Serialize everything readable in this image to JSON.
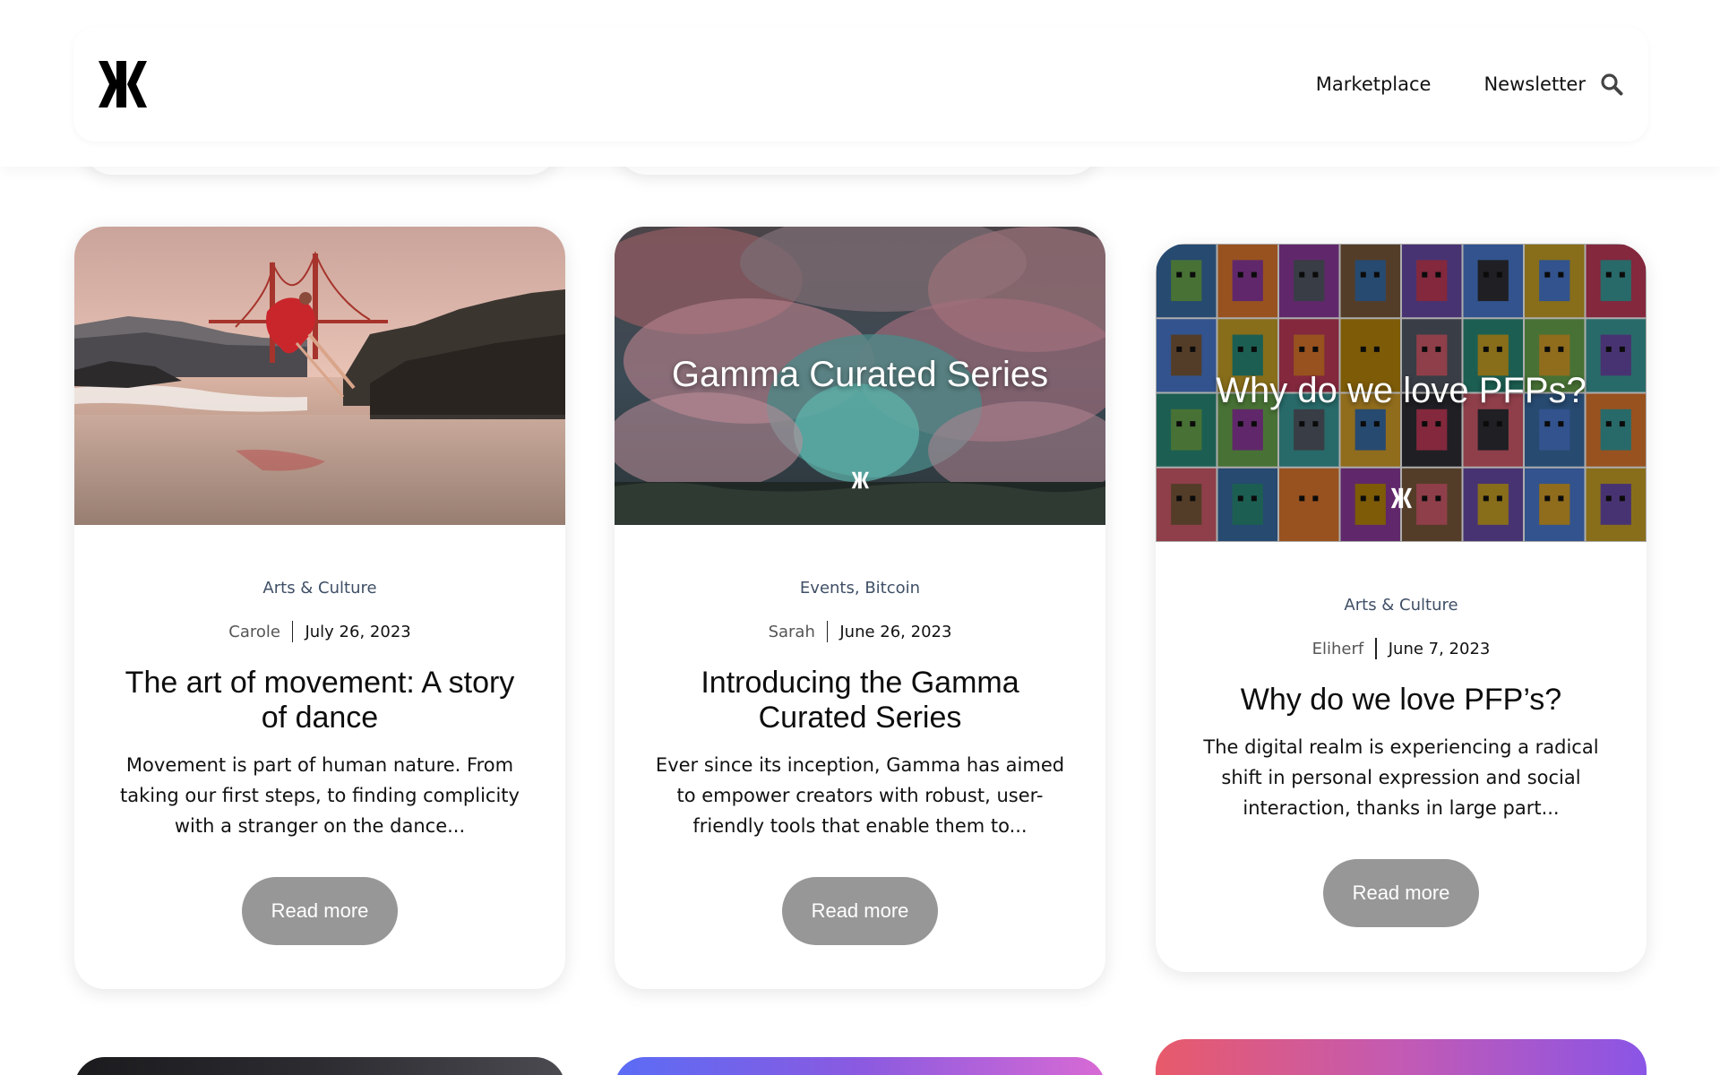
{
  "header": {
    "logo_name": "gamma-logo",
    "nav": [
      "Marketplace",
      "Newsletter"
    ],
    "search_icon": "search-icon"
  },
  "cards": [
    {
      "categories": [
        "Arts & Culture"
      ],
      "author": "Carole",
      "date": "July 26, 2023",
      "title": "The art of movement: A story of dance",
      "excerpt": "Movement is part of human nature. From taking our first steps, to finding complicity with a stranger on the dance...",
      "button": "Read more",
      "image_caption": ""
    },
    {
      "categories": [
        "Events",
        "Bitcoin"
      ],
      "author": "Sarah",
      "date": "June 26, 2023",
      "title": "Introducing the Gamma Curated Series",
      "excerpt": "Ever since its inception, Gamma has aimed to empower creators with robust, user-friendly tools that enable them to...",
      "button": "Read more",
      "image_caption": "Gamma Curated Series"
    },
    {
      "categories": [
        "Arts & Culture"
      ],
      "author": "Eliherf",
      "date": "June 7, 2023",
      "title": "Why do we love PFP’s?",
      "excerpt": "The digital realm is experiencing a radical shift in personal expression and social interaction, thanks in large part...",
      "button": "Read more",
      "image_caption": "Why do we love PFPs?"
    }
  ],
  "colors": {
    "button_bg": "#979797",
    "category_text": "#3f4f66"
  }
}
